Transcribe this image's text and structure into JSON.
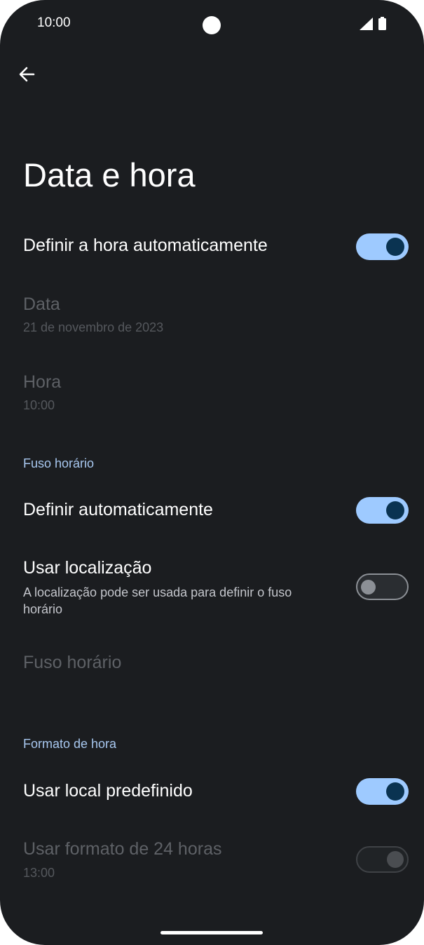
{
  "status_bar": {
    "time": "10:00"
  },
  "header": {
    "title": "Data e hora"
  },
  "auto_time": {
    "label": "Definir a hora automaticamente",
    "state": "on"
  },
  "date": {
    "label": "Data",
    "value": "21 de novembro de 2023"
  },
  "time_row": {
    "label": "Hora",
    "value": "10:00"
  },
  "timezone_section": {
    "header": "Fuso horário"
  },
  "auto_timezone": {
    "label": "Definir automaticamente",
    "state": "on"
  },
  "use_location": {
    "label": "Usar localização",
    "description": "A localização pode ser usada para definir o fuso horário",
    "state": "off"
  },
  "timezone": {
    "label": "Fuso horário"
  },
  "format_section": {
    "header": "Formato de hora"
  },
  "locale_default": {
    "label": "Usar local predefinido",
    "state": "on"
  },
  "format_24h": {
    "label": "Usar formato de 24 horas",
    "value": "13:00",
    "state": "on-disabled"
  },
  "colors": {
    "background": "#1b1d20",
    "accent": "#9ecaff",
    "section_header": "#a8c8f0",
    "disabled_text": "#5e6166"
  },
  "icons": {
    "back": "arrow-left-icon",
    "signal": "cellular-signal-icon",
    "battery": "battery-icon"
  }
}
